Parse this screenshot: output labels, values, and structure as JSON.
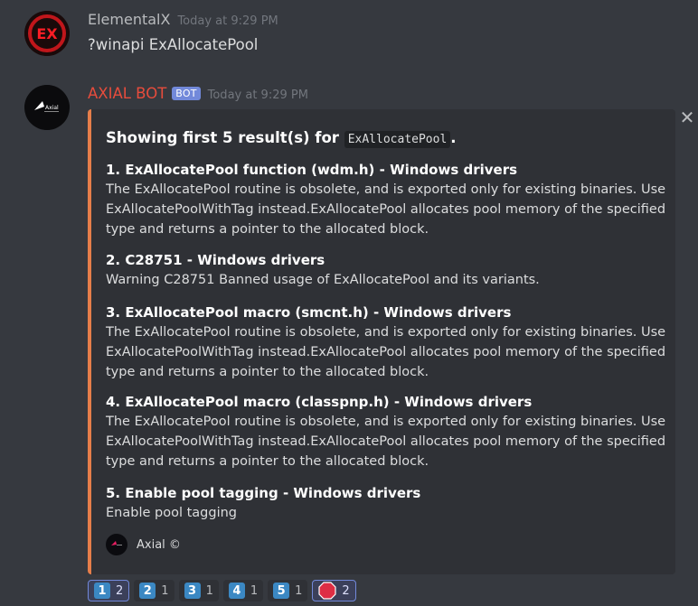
{
  "messages": [
    {
      "username": "ElementalX",
      "timestamp": "Today at 9:29 PM",
      "text": "?winapi ExAllocatePool",
      "name_color": "#b9bbbe"
    },
    {
      "username": "AXIAL BOT",
      "bot_tag": "BOT",
      "timestamp": "Today at 9:29 PM",
      "name_color": "#e74c3c"
    }
  ],
  "embed": {
    "title_prefix": "Showing first 5 result(s) for ",
    "title_code": "ExAllocatePool",
    "title_suffix": ".",
    "accent_color": "#e67e4a",
    "fields": [
      {
        "name": "1. ExAllocatePool function (wdm.h) - Windows drivers",
        "value": "The ExAllocatePool routine is obsolete, and is exported only for existing binaries. Use ExAllocatePoolWithTag instead.ExAllocatePool allocates pool memory of the specified type and returns a pointer to the allocated block."
      },
      {
        "name": "2. C28751 - Windows drivers",
        "value": "Warning C28751 Banned usage of ExAllocatePool and its variants."
      },
      {
        "name": "3. ExAllocatePool macro (smcnt.h) - Windows drivers",
        "value": "The ExAllocatePool routine is obsolete, and is exported only for existing binaries. Use ExAllocatePoolWithTag instead.ExAllocatePool allocates pool memory of the specified type and returns a pointer to the allocated block."
      },
      {
        "name": "4. ExAllocatePool macro (classpnp.h) - Windows drivers",
        "value": "The ExAllocatePool routine is obsolete, and is exported only for existing binaries. Use ExAllocatePoolWithTag instead.ExAllocatePool allocates pool memory of the specified type and returns a pointer to the allocated block."
      },
      {
        "name": "5. Enable pool tagging - Windows drivers",
        "value": "Enable pool tagging"
      }
    ],
    "footer_text": "Axial ©"
  },
  "close_glyph": "✕",
  "reactions": [
    {
      "emoji": "1",
      "count": "2",
      "icon": "keycap-1-icon"
    },
    {
      "emoji": "2",
      "count": "1",
      "icon": "keycap-2-icon"
    },
    {
      "emoji": "3",
      "count": "1",
      "icon": "keycap-3-icon"
    },
    {
      "emoji": "4",
      "count": "1",
      "icon": "keycap-4-icon"
    },
    {
      "emoji": "5",
      "count": "1",
      "icon": "keycap-5-icon"
    },
    {
      "emoji": "stop-sign",
      "count": "2",
      "icon": "stop-sign-icon"
    }
  ]
}
